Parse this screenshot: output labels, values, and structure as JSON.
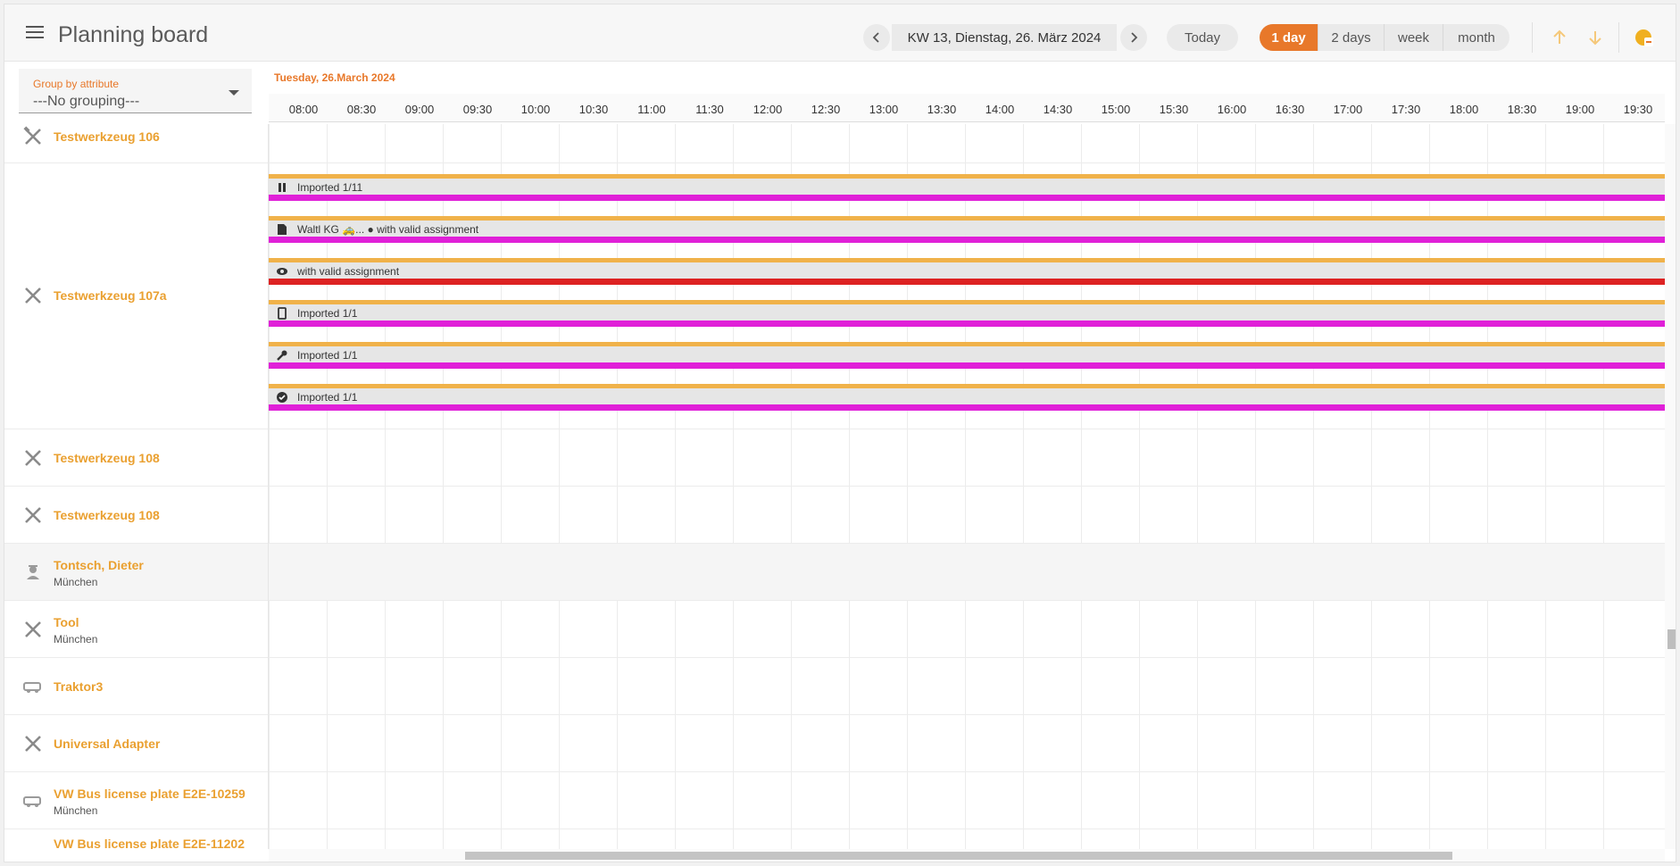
{
  "header": {
    "title": "Planning board",
    "date_text": "KW 13, Dienstag, 26. März 2024",
    "today_label": "Today",
    "view_modes": [
      "1 day",
      "2 days",
      "week",
      "month"
    ],
    "active_view": "1 day",
    "accent_color": "#e8782a"
  },
  "group_select": {
    "label": "Group by attribute",
    "value": "---No grouping---"
  },
  "timeline": {
    "day_label": "Tuesday, 26.March 2024",
    "ticks": [
      "08:00",
      "08:30",
      "09:00",
      "09:30",
      "10:00",
      "10:30",
      "11:00",
      "11:30",
      "12:00",
      "12:30",
      "13:00",
      "13:30",
      "14:00",
      "14:30",
      "15:00",
      "15:30",
      "16:00",
      "16:30",
      "17:00",
      "17:30",
      "18:00",
      "18:30",
      "19:00",
      "19:30"
    ]
  },
  "rows": {
    "r0": {
      "name": "Testwerkzeug 106",
      "icon": "tool-icon"
    },
    "r1": {
      "name": "Testwerkzeug 107a",
      "icon": "tool-icon"
    },
    "r2": {
      "name": "Testwerkzeug 108",
      "icon": "tool-icon"
    },
    "r3": {
      "name": "Testwerkzeug 108",
      "icon": "tool-icon"
    },
    "r4": {
      "name": "Tontsch, Dieter",
      "sub": "München",
      "icon": "worker-icon"
    },
    "r5": {
      "name": "Tool",
      "sub": "München",
      "icon": "tool-icon"
    },
    "r6": {
      "name": "Traktor3",
      "icon": "vehicle-icon"
    },
    "r7": {
      "name": "Universal Adapter",
      "icon": "tool-icon"
    },
    "r8": {
      "name": "VW Bus license plate E2E-10259",
      "sub": "München",
      "icon": "vehicle-icon"
    },
    "r9": {
      "name": "VW Bus license plate E2E-11202",
      "icon": "vehicle-icon"
    }
  },
  "bookings": {
    "b0": {
      "label": "Imported 1/11",
      "icon": "pause-icon"
    },
    "b1": {
      "label": "Waltl KG 🚕... ● with valid assignment",
      "icon": "document-icon"
    },
    "b2": {
      "label": "with valid assignment",
      "icon": "eye-icon"
    },
    "b3": {
      "label": "Imported 1/1",
      "icon": "phone-icon"
    },
    "b4": {
      "label": "Imported 1/1",
      "icon": "wrench-icon"
    },
    "b5": {
      "label": "Imported 1/1",
      "icon": "check-circle-icon"
    }
  }
}
